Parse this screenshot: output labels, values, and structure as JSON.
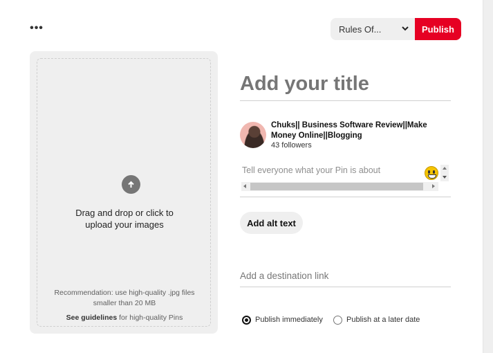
{
  "toolbar": {
    "more_icon": "more-horizontal-icon",
    "board_select": "Rules Of...",
    "publish_label": "Publish",
    "publish_color": "#e60023"
  },
  "upload": {
    "icon": "arrow-up-icon",
    "line1": "Drag and drop or click to",
    "line2": "upload your images",
    "rec_line1": "Recommendation: use high-quality .jpg files",
    "rec_line2": "smaller than 20 MB",
    "guidelines_link": "See guidelines",
    "guidelines_rest": " for high-quality Pins"
  },
  "pin": {
    "title_placeholder": "Add your title",
    "description_placeholder": "Tell everyone what your Pin is about",
    "emoji_icon": "smiley-emoji-icon",
    "alt_text_label": "Add alt text",
    "link_placeholder": "Add a destination link"
  },
  "user": {
    "name_line1": "Chuks|| Business Software Review||Make",
    "name_line2": "Money Online||Blogging",
    "followers": "43 followers"
  },
  "publish_options": {
    "immediately": "Publish immediately",
    "later": "Publish at a later date",
    "selected": "immediately"
  }
}
